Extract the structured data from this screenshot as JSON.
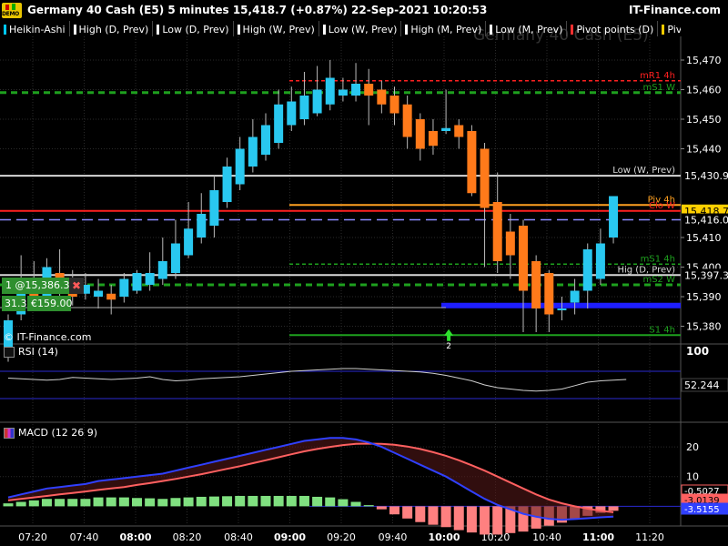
{
  "window": {
    "title": "Germany 40 Cash (E5) 5 minutes 15,418.7 (+0.87%) 22-Sep-2021 10:20:53",
    "brand": "IT-Finance.com",
    "badge": "DEMO"
  },
  "legend": [
    {
      "label": "Heikin-Ashi",
      "color": "#00c8ff"
    },
    {
      "label": "High (D, Prev)",
      "color": "#ffffff"
    },
    {
      "label": "Low (D, Prev)",
      "color": "#ffffff"
    },
    {
      "label": "High (W, Prev)",
      "color": "#ffffff"
    },
    {
      "label": "Low (W, Prev)",
      "color": "#ffffff"
    },
    {
      "label": "High (M, Prev)",
      "color": "#ffffff"
    },
    {
      "label": "Low (M, Prev)",
      "color": "#ffffff"
    },
    {
      "label": "Pivot points (D)",
      "color": "#ff3030"
    },
    {
      "label": "Pivot p",
      "color": "#ffcc00"
    }
  ],
  "watermark": "Germany 40 Cash (E5)",
  "colors": {
    "bull": "#29c8f0",
    "bear": "#ff7a1a",
    "grid": "#2a2a2a",
    "green_dash": "#1ea01e",
    "red_dash": "#ff2020",
    "white_line": "#d8d8d8",
    "blue_band": "#1e1eff",
    "lavender_dash": "#8a8aff",
    "macd_line": "#3040ff",
    "signal_line": "#ff6060",
    "hist_pos": "#80e080",
    "hist_neg": "#ff8080",
    "rsi_line": "#cfcfcf"
  },
  "price_axis": {
    "ticks": [
      "15,470",
      "15,460",
      "15,450",
      "15,440",
      "15,410",
      "15,400",
      "15,390",
      "15,380"
    ],
    "tick_values": [
      15470,
      15460,
      15450,
      15440,
      15410,
      15400,
      15390,
      15380
    ],
    "min": 15374,
    "max": 15478
  },
  "levels": [
    {
      "label": "mR1 4h",
      "value": 15463,
      "color": "#ff2020",
      "style": "dash",
      "tag": ""
    },
    {
      "label": "mS1 W",
      "value": 15459,
      "color": "#1ea01e",
      "style": "bigdash",
      "tag": ""
    },
    {
      "label": "Low (W, Prev)",
      "value": 15430.9,
      "color": "#d8d8d8",
      "style": "solid",
      "tag": "15,430.9"
    },
    {
      "label": "Piv 4h",
      "value": 15421,
      "color": "#ffa020",
      "style": "solid",
      "tag": ""
    },
    {
      "label": "Clo W",
      "value": 15419,
      "color": "#ff2020",
      "style": "solid",
      "tag": "15,418.7"
    },
    {
      "label": "",
      "value": 15416,
      "color": "#8a8aff",
      "style": "longdash",
      "tag": "15,416.0"
    },
    {
      "label": "mS1 4h",
      "value": 15401,
      "color": "#1ea01e",
      "style": "dash",
      "tag": ""
    },
    {
      "label": "Hig (D, Prev)",
      "value": 15397.3,
      "color": "#d8d8d8",
      "style": "solid",
      "tag": "15,397.3"
    },
    {
      "label": "mS2 W",
      "value": 15394,
      "color": "#1ea01e",
      "style": "bigdash",
      "tag": ""
    },
    {
      "label": "",
      "value": 15387,
      "color": "#1e1eff",
      "style": "band",
      "tag": ""
    },
    {
      "label": "S1 4h",
      "value": 15377,
      "color": "#1ea01e",
      "style": "solid",
      "tag": ""
    }
  ],
  "trade": {
    "position": "1 @15,386.3",
    "qty": "31.3",
    "pnl": "€159.00",
    "close_glyph": "✖"
  },
  "signal_arrow": {
    "label": "2"
  },
  "copyright": "© IT-Finance.com",
  "rsi": {
    "title": "RSI (14)",
    "top_tick": "100",
    "value_tag": "52.244",
    "values": [
      60,
      59,
      58,
      57,
      58,
      61,
      60,
      59,
      58,
      59,
      60,
      62,
      58,
      56,
      57,
      59,
      60,
      61,
      62,
      64,
      66,
      68,
      70,
      71,
      72,
      73,
      74,
      74,
      73,
      72,
      71,
      70,
      69,
      67,
      64,
      60,
      56,
      50,
      46,
      44,
      42,
      41,
      42,
      44,
      49,
      54,
      56,
      57,
      58
    ]
  },
  "macd": {
    "title": "MACD (12 26 9)",
    "ticks": [
      "20",
      "10"
    ],
    "tick_values": [
      20,
      10
    ],
    "tags": [
      "-0.5027",
      "-3.0139",
      "-3.5155"
    ],
    "min": -6,
    "max": 24,
    "macd": [
      3,
      4,
      5,
      6,
      6.5,
      7,
      7.5,
      8.5,
      9,
      9.5,
      10,
      10.5,
      11,
      12,
      13,
      14,
      15,
      16,
      17,
      18,
      19,
      20,
      21,
      22,
      22.5,
      23,
      23,
      22.5,
      21.5,
      20,
      18,
      16,
      14,
      12,
      10,
      7.5,
      5,
      2.5,
      0.5,
      -1,
      -2.5,
      -3.5,
      -4.2,
      -4.5,
      -4.3,
      -4,
      -3.7,
      -3.5
    ],
    "signal": [
      2,
      2.5,
      3,
      3.5,
      4,
      4.5,
      5,
      5.5,
      6,
      6.5,
      7.2,
      7.8,
      8.5,
      9.2,
      10,
      10.8,
      11.7,
      12.6,
      13.5,
      14.5,
      15.5,
      16.5,
      17.5,
      18.5,
      19.3,
      20,
      20.6,
      21,
      21.1,
      21,
      20.7,
      20.1,
      19.3,
      18.2,
      17,
      15.5,
      13.8,
      12,
      10,
      8,
      6,
      4,
      2.3,
      1,
      0,
      -0.8,
      -1.5,
      -2
    ],
    "hist": [
      1,
      1.5,
      2,
      2.5,
      2.5,
      2.5,
      2.5,
      3,
      3,
      3,
      2.8,
      2.7,
      2.5,
      2.8,
      3,
      3.2,
      3.3,
      3.4,
      3.5,
      3.5,
      3.5,
      3.5,
      3.5,
      3.5,
      3.2,
      3,
      2.4,
      1.5,
      0.4,
      -1,
      -2.7,
      -4.1,
      -5.3,
      -6.2,
      -7,
      -8,
      -8.8,
      -9.5,
      -9.5,
      -9,
      -8.5,
      -7.5,
      -6.5,
      -5.5,
      -4.3,
      -3.2,
      -2.2,
      -1.5
    ]
  },
  "time_axis": {
    "labels": [
      "07:20",
      "07:40",
      "08:00",
      "08:20",
      "08:40",
      "09:00",
      "09:20",
      "09:40",
      "10:00",
      "10:20",
      "10:40",
      "11:00",
      "11:20"
    ],
    "bold": [
      false,
      false,
      true,
      false,
      false,
      true,
      false,
      false,
      true,
      false,
      false,
      true,
      false
    ]
  },
  "candles": [
    {
      "o": 15370,
      "c": 15382,
      "h": 15384,
      "l": 15368
    },
    {
      "o": 15384,
      "c": 15396,
      "h": 15404,
      "l": 15382
    },
    {
      "o": 15394,
      "c": 15390,
      "h": 15402,
      "l": 15388
    },
    {
      "o": 15390,
      "c": 15400,
      "h": 15403,
      "l": 15388
    },
    {
      "o": 15398,
      "c": 15393,
      "h": 15406,
      "l": 15390
    },
    {
      "o": 15393,
      "c": 15390,
      "h": 15399,
      "l": 15387
    },
    {
      "o": 15391,
      "c": 15394,
      "h": 15398,
      "l": 15389
    },
    {
      "o": 15390,
      "c": 15392,
      "h": 15396,
      "l": 15386
    },
    {
      "o": 15391,
      "c": 15389,
      "h": 15394,
      "l": 15384
    },
    {
      "o": 15390,
      "c": 15396,
      "h": 15398,
      "l": 15388
    },
    {
      "o": 15392,
      "c": 15398,
      "h": 15399,
      "l": 15391
    },
    {
      "o": 15394,
      "c": 15398,
      "h": 15405,
      "l": 15392
    },
    {
      "o": 15396,
      "c": 15402,
      "h": 15410,
      "l": 15394
    },
    {
      "o": 15398,
      "c": 15408,
      "h": 15416,
      "l": 15396
    },
    {
      "o": 15404,
      "c": 15413,
      "h": 15422,
      "l": 15403
    },
    {
      "o": 15410,
      "c": 15418,
      "h": 15425,
      "l": 15408
    },
    {
      "o": 15414,
      "c": 15426,
      "h": 15431,
      "l": 15410
    },
    {
      "o": 15422,
      "c": 15434,
      "h": 15437,
      "l": 15420
    },
    {
      "o": 15428,
      "c": 15440,
      "h": 15444,
      "l": 15426
    },
    {
      "o": 15434,
      "c": 15444,
      "h": 15450,
      "l": 15432
    },
    {
      "o": 15438,
      "c": 15448,
      "h": 15452,
      "l": 15436
    },
    {
      "o": 15442,
      "c": 15455,
      "h": 15460,
      "l": 15440
    },
    {
      "o": 15448,
      "c": 15456,
      "h": 15461,
      "l": 15446
    },
    {
      "o": 15450,
      "c": 15458,
      "h": 15466,
      "l": 15448
    },
    {
      "o": 15452,
      "c": 15460,
      "h": 15468,
      "l": 15451
    },
    {
      "o": 15455,
      "c": 15464,
      "h": 15470,
      "l": 15453
    },
    {
      "o": 15458,
      "c": 15460,
      "h": 15464,
      "l": 15456
    },
    {
      "o": 15458,
      "c": 15462,
      "h": 15469,
      "l": 15456
    },
    {
      "o": 15462,
      "c": 15458,
      "h": 15467,
      "l": 15448
    },
    {
      "o": 15460,
      "c": 15455,
      "h": 15463,
      "l": 15452
    },
    {
      "o": 15458,
      "c": 15452,
      "h": 15461,
      "l": 15448
    },
    {
      "o": 15455,
      "c": 15444,
      "h": 15458,
      "l": 15440
    },
    {
      "o": 15450,
      "c": 15440,
      "h": 15452,
      "l": 15436
    },
    {
      "o": 15446,
      "c": 15441,
      "h": 15450,
      "l": 15438
    },
    {
      "o": 15446,
      "c": 15447,
      "h": 15460,
      "l": 15445
    },
    {
      "o": 15448,
      "c": 15444,
      "h": 15450,
      "l": 15440
    },
    {
      "o": 15446,
      "c": 15425,
      "h": 15448,
      "l": 15424
    },
    {
      "o": 15440,
      "c": 15420,
      "h": 15442,
      "l": 15400
    },
    {
      "o": 15422,
      "c": 15402,
      "h": 15432,
      "l": 15398
    },
    {
      "o": 15412,
      "c": 15404,
      "h": 15418,
      "l": 15396
    },
    {
      "o": 15414,
      "c": 15392,
      "h": 15416,
      "l": 15378
    },
    {
      "o": 15402,
      "c": 15386,
      "h": 15404,
      "l": 15378
    },
    {
      "o": 15398,
      "c": 15384,
      "h": 15399,
      "l": 15378
    },
    {
      "o": 15386,
      "c": 15386,
      "h": 15390,
      "l": 15382
    },
    {
      "o": 15388,
      "c": 15392,
      "h": 15396,
      "l": 15384
    },
    {
      "o": 15392,
      "c": 15406,
      "h": 15408,
      "l": 15386
    },
    {
      "o": 15396,
      "c": 15408,
      "h": 15413,
      "l": 15394
    },
    {
      "o": 15410,
      "c": 15424,
      "h": 15424,
      "l": 15408
    }
  ]
}
